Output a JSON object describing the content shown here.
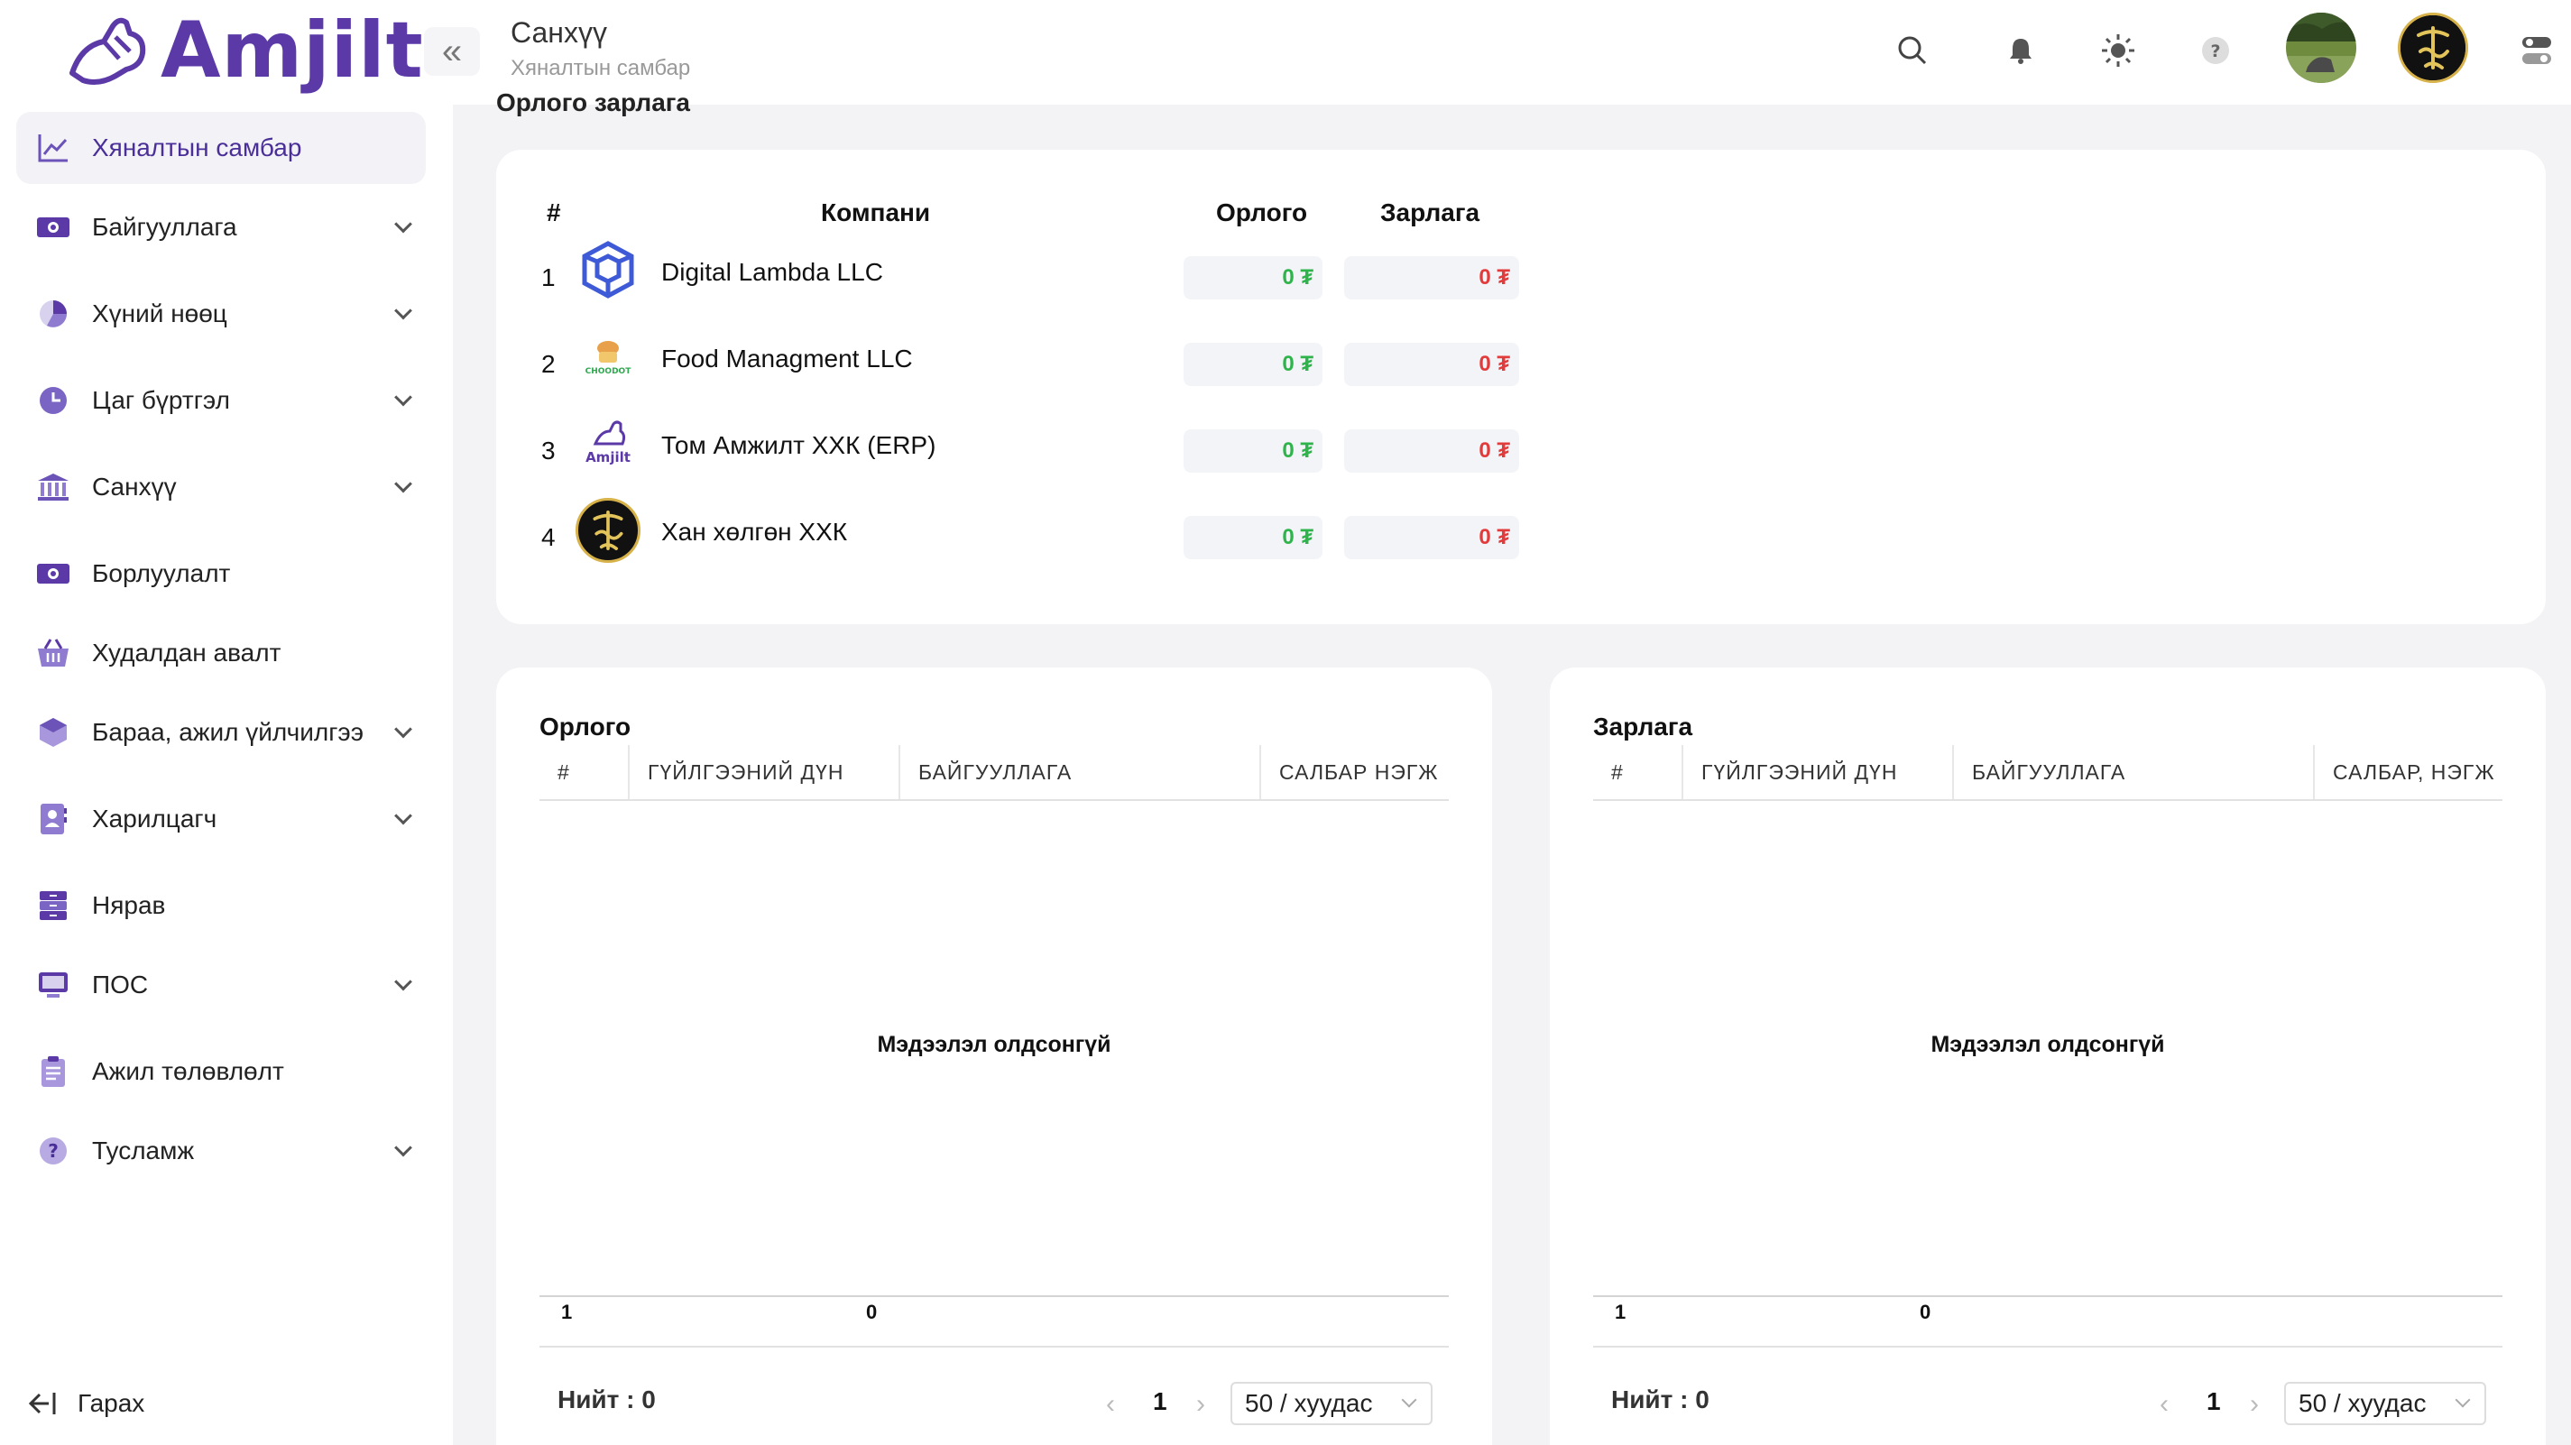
{
  "brand": {
    "name": "Amjilt",
    "color": "#5b3aa8"
  },
  "header": {
    "title": "Санхүү",
    "subtitle": "Хяналтын самбар",
    "collapse_glyph": "«"
  },
  "sidebar": {
    "items": [
      {
        "label": "Хяналтын самбар",
        "icon": "chart-line-icon",
        "active": true
      },
      {
        "label": "Байгууллага",
        "icon": "building-icon",
        "expandable": true
      },
      {
        "label": "Хүний нөөц",
        "icon": "pie-chart-icon",
        "expandable": true
      },
      {
        "label": "Цаг бүртгэл",
        "icon": "clock-icon",
        "expandable": true
      },
      {
        "label": "Санхүү",
        "icon": "bank-icon",
        "expandable": true
      },
      {
        "label": "Борлуулалт",
        "icon": "cash-icon"
      },
      {
        "label": "Худалдан авалт",
        "icon": "basket-icon"
      },
      {
        "label": "Бараа, ажил үйлчилгээ",
        "icon": "box-icon",
        "expandable": true
      },
      {
        "label": "Харилцагч",
        "icon": "contact-icon",
        "expandable": true
      },
      {
        "label": "Нярав",
        "icon": "drawer-icon"
      },
      {
        "label": "ПОС",
        "icon": "monitor-icon",
        "expandable": true
      },
      {
        "label": "Ажил төлөвлөлт",
        "icon": "clipboard-icon"
      },
      {
        "label": "Тусламж",
        "icon": "help-icon",
        "expandable": true
      }
    ],
    "logout": "Гарах"
  },
  "section_heading": "Орлого зарлага",
  "summary": {
    "headers": {
      "num": "#",
      "company": "Компани",
      "income": "Орлого",
      "expense": "Зарлага"
    },
    "rows": [
      {
        "num": "1",
        "company": "Digital Lambda LLC",
        "income": "0 ₮",
        "expense": "0 ₮"
      },
      {
        "num": "2",
        "company": "Food Managment LLC",
        "income": "0 ₮",
        "expense": "0 ₮"
      },
      {
        "num": "3",
        "company": "Том Амжилт ХХК (ERP)",
        "income": "0 ₮",
        "expense": "0 ₮"
      },
      {
        "num": "4",
        "company": "Хан хөлгөн ХХК",
        "income": "0 ₮",
        "expense": "0 ₮"
      }
    ],
    "income_color": "#2fb34b",
    "expense_color": "#e23b3b"
  },
  "income_table": {
    "title": "Орлого",
    "columns": [
      "#",
      "ГҮЙЛГЭЭНИЙ ДҮН",
      "БАЙГУУЛЛАГА",
      "САЛБАР НЭГЖ"
    ],
    "empty_text": "Мэдээлэл олдсонгүй",
    "footer": {
      "count": "1",
      "sum": "0"
    },
    "total_label": "Нийт : 0",
    "page": "1",
    "page_size": "50 / хуудас"
  },
  "expense_table": {
    "title": "Зарлага",
    "columns": [
      "#",
      "ГҮЙЛГЭЭНИЙ ДҮН",
      "БАЙГУУЛЛАГА",
      "САЛБАР, НЭГЖ"
    ],
    "empty_text": "Мэдээлэл олдсонгүй",
    "footer": {
      "count": "1",
      "sum": "0"
    },
    "total_label": "Нийт : 0",
    "page": "1",
    "page_size": "50 / хуудас"
  },
  "pager_glyphs": {
    "prev": "‹",
    "next": "›"
  }
}
